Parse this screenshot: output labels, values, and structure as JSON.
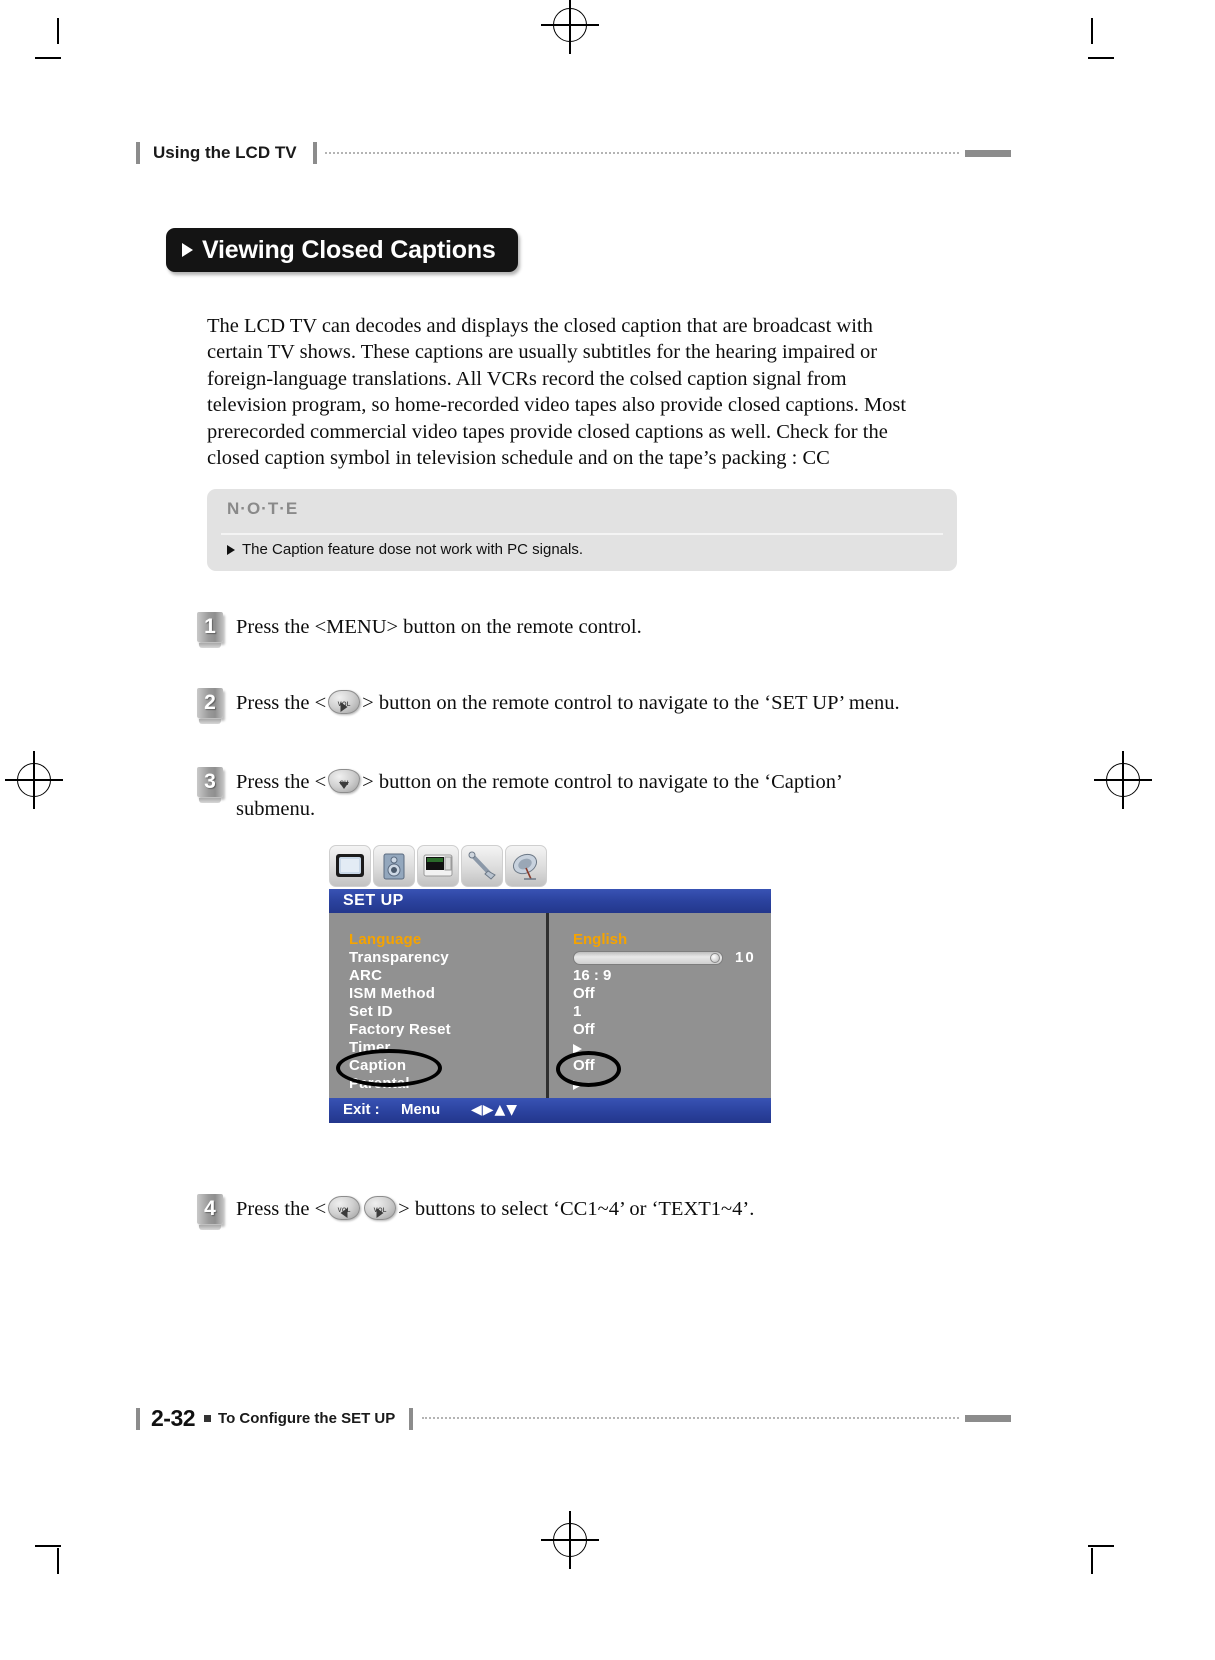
{
  "header": {
    "title": "Using the LCD TV"
  },
  "section": {
    "title": "Viewing Closed Captions"
  },
  "intro": {
    "paragraph": "The LCD TV can decodes and displays the closed caption that are broadcast with certain TV shows. These captions are usually subtitles for the hearing impaired or foreign-language translations. All VCRs record the colsed caption signal from television program, so home-recorded video tapes also provide closed captions. Most prerecorded commercial video tapes provide closed captions as well. Check for the closed caption symbol in television schedule and on the tape’s packing : CC"
  },
  "note": {
    "heading": "N·O·T·E",
    "items": [
      "The Caption feature dose not work with PC signals."
    ]
  },
  "steps": [
    {
      "number": "1",
      "text_before": "Press the <MENU> button on the remote control.",
      "text_after": ""
    },
    {
      "number": "2",
      "text_before": "Press the <",
      "key_labels": [
        "VOL"
      ],
      "text_after": "> button on the remote control to navigate to the ‘SET UP’ menu."
    },
    {
      "number": "3",
      "text_before": "Press the <",
      "key_labels": [
        "CH"
      ],
      "text_after": "> button on the remote control to navigate to the ‘Caption’ submenu."
    },
    {
      "number": "4",
      "text_before": "Press the <",
      "key_labels": [
        "VOL",
        "VOL"
      ],
      "text_after": "> buttons to select ‘CC1~4’ or ‘TEXT1~4’."
    }
  ],
  "osd": {
    "title": "SET UP",
    "tabs": [
      {
        "name": "picture-tab",
        "icon": "tv-screen-icon"
      },
      {
        "name": "sound-tab",
        "icon": "speaker-icon"
      },
      {
        "name": "screen-tab",
        "icon": "monitor-icon"
      },
      {
        "name": "setup-tab",
        "icon": "wrench-icon"
      },
      {
        "name": "antenna-tab",
        "icon": "satellite-dish-icon"
      }
    ],
    "menu_items": [
      {
        "label": "Language",
        "value": "English",
        "selected": true,
        "type": "text"
      },
      {
        "label": "Transparency",
        "value": "10",
        "selected": false,
        "type": "slider"
      },
      {
        "label": "ARC",
        "value": "16 : 9",
        "selected": false,
        "type": "text"
      },
      {
        "label": "ISM Method",
        "value": "Off",
        "selected": false,
        "type": "text"
      },
      {
        "label": "Set ID",
        "value": "1",
        "selected": false,
        "type": "text"
      },
      {
        "label": "Factory Reset",
        "value": "Off",
        "selected": false,
        "type": "text"
      },
      {
        "label": "Timer",
        "value": "",
        "selected": false,
        "type": "arrow"
      },
      {
        "label": "Caption",
        "value": "Off",
        "selected": false,
        "type": "text"
      },
      {
        "label": "Parental",
        "value": "",
        "selected": false,
        "type": "arrow"
      }
    ],
    "footer": {
      "exit_label": "Exit :",
      "menu_label": "Menu",
      "arrows": "◀▶▲▼"
    },
    "slider": {
      "value": "10"
    }
  },
  "footer": {
    "page": "2-32",
    "label": "To Configure the SET UP"
  },
  "colors": {
    "osd_blue": "#2b429e",
    "osd_gray": "#919191",
    "osd_highlight": "#f5a300",
    "pill_black": "#141414",
    "note_bg": "#e2e2e2",
    "rule_gray": "#8c8c8c"
  }
}
